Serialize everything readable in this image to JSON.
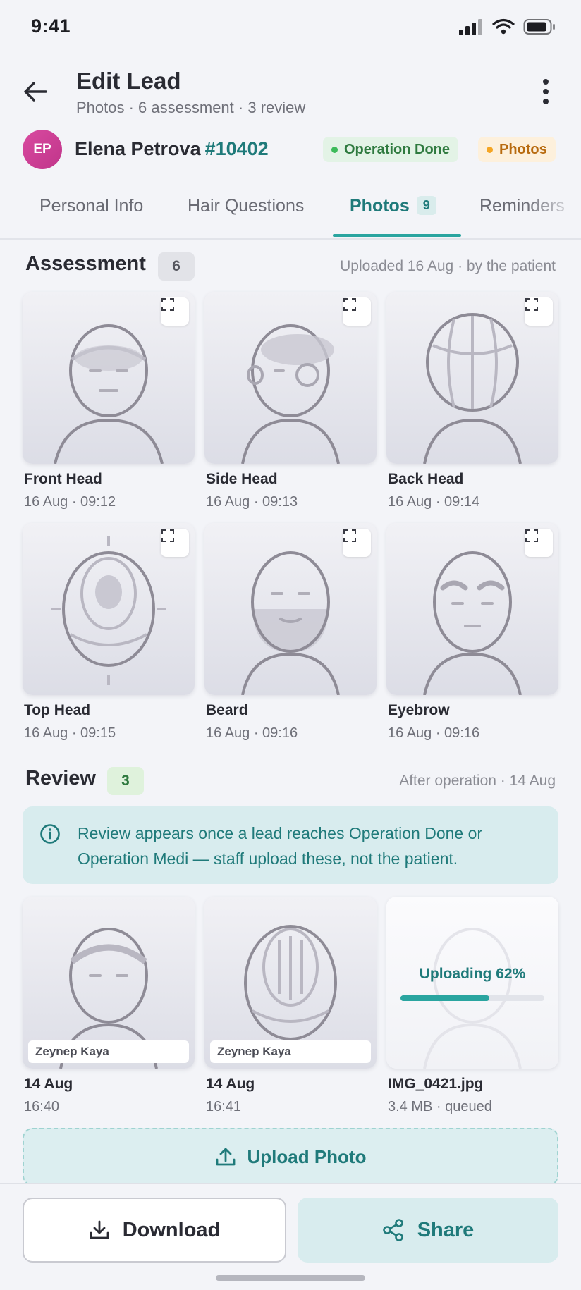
{
  "status_bar": {
    "time": "9:41"
  },
  "header": {
    "title": "Edit Lead",
    "subtitle": "Photos · 6 assessment · 3 review"
  },
  "lead": {
    "initials": "EP",
    "name": "Elena Petrova",
    "id": "#10402",
    "badges": [
      {
        "label": "Operation Done",
        "color": "#3dbb5a"
      },
      {
        "label": "Photos",
        "color": "#f5a523"
      }
    ]
  },
  "tabs": [
    {
      "label": "Personal Info"
    },
    {
      "label": "Hair Questions"
    },
    {
      "label": "Photos",
      "count": "9",
      "active": true
    },
    {
      "label": "Reminders"
    }
  ],
  "assessment": {
    "title": "Assessment",
    "count": "6",
    "meta": "Uploaded 16 Aug · by the patient",
    "photos": [
      {
        "label": "Front Head",
        "time": "16 Aug · 09:12"
      },
      {
        "label": "Side Head",
        "time": "16 Aug · 09:13"
      },
      {
        "label": "Back Head",
        "time": "16 Aug · 09:14"
      },
      {
        "label": "Top Head",
        "time": "16 Aug · 09:15"
      },
      {
        "label": "Beard",
        "time": "16 Aug · 09:16"
      },
      {
        "label": "Eyebrow",
        "time": "16 Aug · 09:16"
      }
    ]
  },
  "review": {
    "title": "Review",
    "count": "3",
    "meta": "After operation · 14 Aug",
    "info": "Review appears once a lead reaches Operation Done or Operation Medi — staff upload these, not the patient.",
    "photos": [
      {
        "uploader": "Zeynep Kaya",
        "label": "14 Aug",
        "time": "16:40"
      },
      {
        "uploader": "Zeynep Kaya",
        "label": "14 Aug",
        "time": "16:41"
      },
      {
        "upload_status": "Uploading 62%",
        "progress": 0.62,
        "label": "IMG_0421.jpg",
        "time": "3.4 MB · queued"
      }
    ],
    "upload_button": "Upload Photo"
  },
  "actions": {
    "download": "Download",
    "share": "Share"
  },
  "colors": {
    "accent": "#1f7a7a",
    "accent_light": "#d8ecee",
    "progress": "#2aa5a0"
  }
}
